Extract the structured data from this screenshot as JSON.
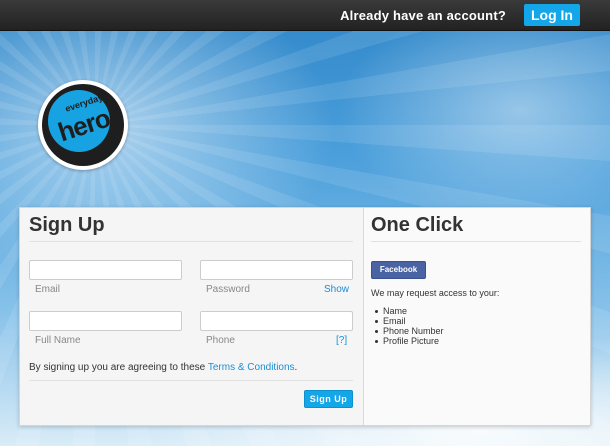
{
  "topbar": {
    "prompt": "Already have an account?",
    "login_label": "Log In"
  },
  "logo": {
    "small_word": "everyday",
    "big_word": "hero"
  },
  "signup": {
    "title": "Sign Up",
    "fields": {
      "email": {
        "label": "Email",
        "value": ""
      },
      "password": {
        "label": "Password",
        "value": "",
        "help": "Show"
      },
      "full_name": {
        "label": "Full Name",
        "value": ""
      },
      "phone": {
        "label": "Phone",
        "value": "",
        "help": "[?]"
      }
    },
    "terms_prefix": "By signing up you are agreeing to these",
    "terms_link": "Terms & Conditions",
    "terms_suffix": ".",
    "submit_label": "Sign Up"
  },
  "oneclick": {
    "title": "One Click",
    "facebook_label": "Facebook",
    "request_text": "We may request access to your:",
    "permissions": [
      "Name",
      "Email",
      "Phone Number",
      "Profile Picture"
    ]
  },
  "colors": {
    "accent": "#13a6e8",
    "facebook": "#4a63a3",
    "topbar": "#2b2b2b"
  }
}
